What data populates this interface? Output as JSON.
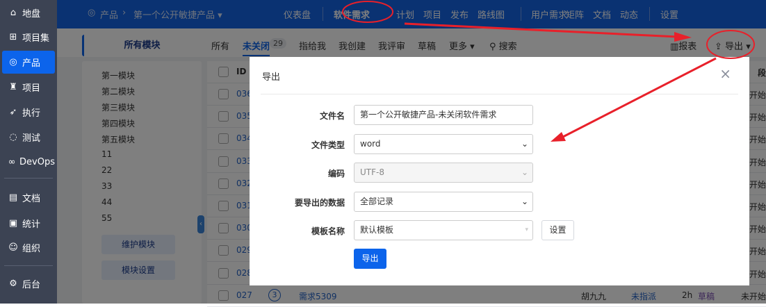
{
  "sidebar": {
    "items": [
      {
        "label": "地盘",
        "icon": "home-icon"
      },
      {
        "label": "项目集",
        "icon": "grid-icon"
      },
      {
        "label": "产品",
        "icon": "bulb-icon"
      },
      {
        "label": "项目",
        "icon": "rocket-icon"
      },
      {
        "label": "执行",
        "icon": "run-icon"
      },
      {
        "label": "测试",
        "icon": "test-icon"
      },
      {
        "label": "DevOps",
        "icon": "infinity-icon"
      },
      {
        "label": "文档",
        "icon": "doc-icon"
      },
      {
        "label": "统计",
        "icon": "chart-icon"
      },
      {
        "label": "组织",
        "icon": "people-icon"
      },
      {
        "label": "后台",
        "icon": "gear-icon"
      }
    ]
  },
  "header": {
    "crumb_root": "产品",
    "product": "第一个公开敏捷产品",
    "nav": [
      "仪表盘",
      "软件需求",
      "计划",
      "项目",
      "发布",
      "路线图",
      "用户需求",
      "矩阵",
      "文档",
      "动态",
      "设置"
    ]
  },
  "subbar": {
    "tabs": [
      "所有",
      "未关闭",
      "指给我",
      "我创建",
      "我评审",
      "草稿",
      "更多"
    ],
    "unclosed_count": "29",
    "search": "搜索",
    "report": "报表",
    "export": "导出"
  },
  "modules": {
    "title": "所有模块",
    "items": [
      "第一模块",
      "第二模块",
      "第三模块",
      "第四模块",
      "第五模块",
      "11",
      "22",
      "33",
      "44",
      "55"
    ],
    "maintain": "维护模块",
    "settings": "模块设置"
  },
  "table": {
    "id_header": "ID",
    "stage_header": "段",
    "ids": [
      "036",
      "035",
      "034",
      "033",
      "032",
      "031",
      "030",
      "029",
      "028"
    ],
    "stage": "开始",
    "last": {
      "id": "027",
      "priority": "3",
      "title": "需求5309",
      "owner": "胡九九",
      "assigned": "未指派",
      "estimate": "2h",
      "status": "草稿",
      "stage": "未开始"
    }
  },
  "modal": {
    "title": "导出",
    "close": "×",
    "fields": [
      {
        "label": "文件名",
        "value": "第一个公开敏捷产品-未关闭软件需求"
      },
      {
        "label": "文件类型",
        "value": "word"
      },
      {
        "label": "编码",
        "value": "UTF-8"
      },
      {
        "label": "要导出的数据",
        "value": "全部记录"
      },
      {
        "label": "模板名称",
        "value": "默认模板"
      }
    ],
    "settings_btn": "设置",
    "export_btn": "导出"
  },
  "annotation_color": "#e8202a"
}
